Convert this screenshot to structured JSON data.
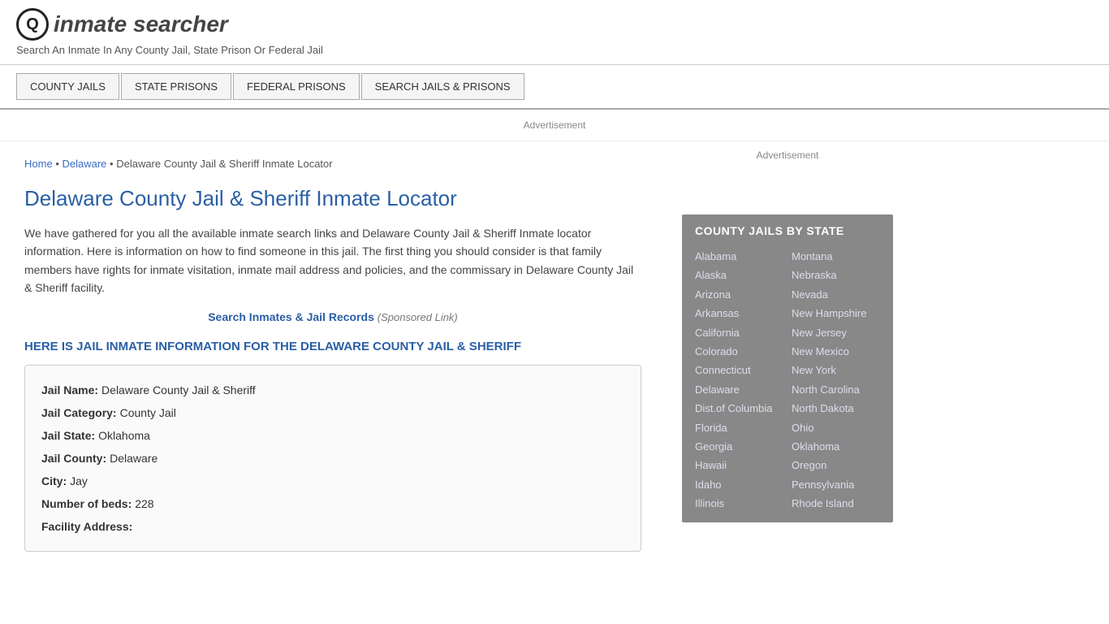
{
  "header": {
    "logo_icon": "🔍",
    "logo_text": "inmate searcher",
    "tagline": "Search An Inmate In Any County Jail, State Prison Or Federal Jail"
  },
  "nav": {
    "items": [
      {
        "label": "COUNTY JAILS",
        "href": "#"
      },
      {
        "label": "STATE PRISONS",
        "href": "#"
      },
      {
        "label": "FEDERAL PRISONS",
        "href": "#"
      },
      {
        "label": "SEARCH JAILS & PRISONS",
        "href": "#"
      }
    ]
  },
  "ad_banner": "Advertisement",
  "breadcrumb": {
    "home_label": "Home",
    "home_href": "#",
    "separator1": " • ",
    "state_label": "Delaware",
    "state_href": "#",
    "separator2": " • ",
    "current": "Delaware County Jail & Sheriff Inmate Locator"
  },
  "page_title": "Delaware County Jail & Sheriff Inmate Locator",
  "description": "We have gathered for you all the available inmate search links and Delaware County Jail & Sheriff Inmate locator information. Here is information on how to find someone in this jail. The first thing you should consider is that family members have rights for inmate visitation, inmate mail address and policies, and the commissary in Delaware County Jail & Sheriff facility.",
  "search_link": {
    "label": "Search Inmates & Jail Records",
    "href": "#",
    "sponsored": "(Sponsored Link)"
  },
  "jail_info_heading": "HERE IS JAIL INMATE INFORMATION FOR THE DELAWARE COUNTY JAIL & SHERIFF",
  "jail_info": {
    "jail_name_label": "Jail Name:",
    "jail_name_value": "Delaware County Jail & Sheriff",
    "jail_category_label": "Jail Category:",
    "jail_category_value": "County Jail",
    "jail_state_label": "Jail State:",
    "jail_state_value": "Oklahoma",
    "jail_county_label": "Jail County:",
    "jail_county_value": "Delaware",
    "city_label": "City:",
    "city_value": "Jay",
    "num_beds_label": "Number of beds:",
    "num_beds_value": "228",
    "facility_address_label": "Facility Address:"
  },
  "sidebar": {
    "ad_label": "Advertisement",
    "state_jails_heading": "COUNTY JAILS BY STATE",
    "states_col1": [
      "Alabama",
      "Alaska",
      "Arizona",
      "Arkansas",
      "California",
      "Colorado",
      "Connecticut",
      "Delaware",
      "Dist.of Columbia",
      "Florida",
      "Georgia",
      "Hawaii",
      "Idaho",
      "Illinois"
    ],
    "states_col2": [
      "Montana",
      "Nebraska",
      "Nevada",
      "New Hampshire",
      "New Jersey",
      "New Mexico",
      "New York",
      "North Carolina",
      "North Dakota",
      "Ohio",
      "Oklahoma",
      "Oregon",
      "Pennsylvania",
      "Rhode Island"
    ]
  }
}
